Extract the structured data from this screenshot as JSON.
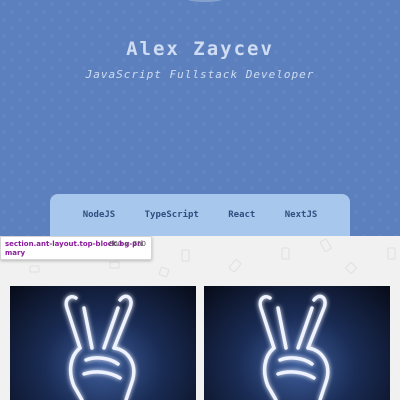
{
  "hero": {
    "name": "Alex Zaycev",
    "role": "JavaScript Fullstack Developer"
  },
  "tech": [
    "NodeJS",
    "TypeScript",
    "React",
    "NextJS"
  ],
  "inspect": {
    "selector_line1": "section.ant-layout.top-block.bg-pri",
    "selector_line2": "mary",
    "size": "800 × 750"
  },
  "colors": {
    "hero_bg": "#5b80bd",
    "tech_panel": "#a8c7ec",
    "hero_text": "#cfdcf3",
    "tech_text": "#2f4f80"
  },
  "cards": [
    {
      "image": "neon-peace-hand"
    },
    {
      "image": "neon-peace-hand"
    }
  ]
}
